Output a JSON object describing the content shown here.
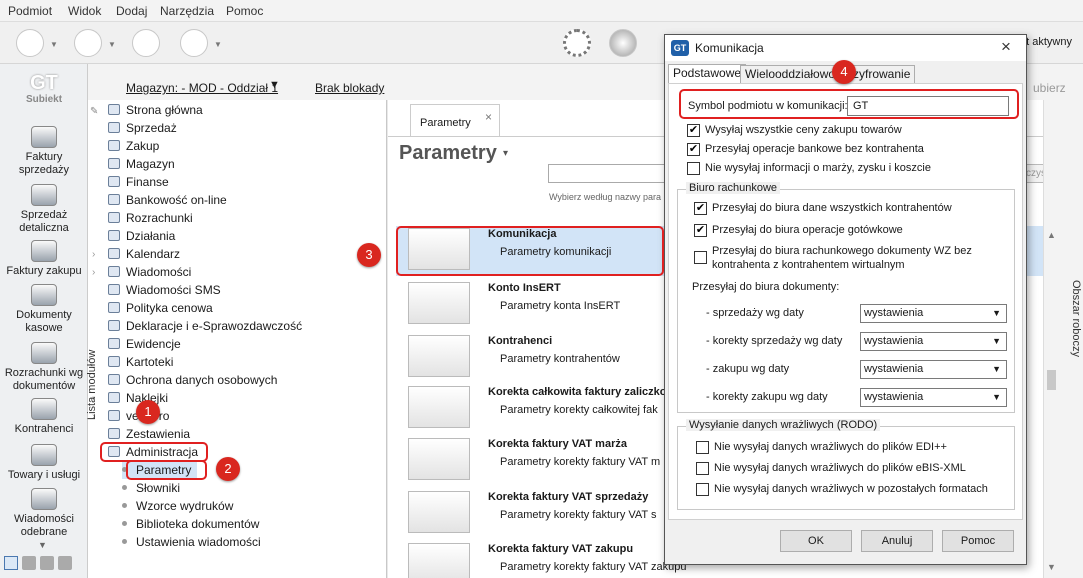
{
  "menubar": {
    "items": [
      "Podmiot",
      "Widok",
      "Dodaj",
      "Narzędzia",
      "Pomoc"
    ]
  },
  "toolbar": {
    "status": "nt aktywny",
    "right_button": "ubierz"
  },
  "app": {
    "logo": "GT",
    "name": "Subiekt"
  },
  "leftnav": {
    "items": [
      {
        "label": "Faktury sprzedaży",
        "icon": "invoice-icon"
      },
      {
        "label": "Sprzedaż detaliczna",
        "icon": "retail-icon"
      },
      {
        "label": "Faktury zakupu",
        "icon": "purchase-icon"
      },
      {
        "label": "Dokumenty kasowe",
        "icon": "cash-icon"
      },
      {
        "label": "Rozrachunki wg dokumentów",
        "icon": "settlements-icon"
      },
      {
        "label": "Kontrahenci",
        "icon": "contractors-icon"
      },
      {
        "label": "Towary i usługi",
        "icon": "goods-icon"
      },
      {
        "label": "Wiadomości odebrane",
        "icon": "messages-icon"
      }
    ]
  },
  "filterbar": {
    "magazyn": "Magazyn: - MOD - Oddział 1",
    "brak_blokady": "Brak blokady"
  },
  "tree": {
    "vertical_label": "Lista modułów",
    "items": [
      "Strona główna",
      "Sprzedaż",
      "Zakup",
      "Magazyn",
      "Finanse",
      "Bankowość on-line",
      "Rozrachunki",
      "Działania",
      "Kalendarz",
      "Wiadomości",
      "Wiadomości SMS",
      "Polityka cenowa",
      "Deklaracje i e-Sprawozdawczość",
      "Ewidencje",
      "Kartoteki",
      "Ochrona danych osobowych",
      "Naklejki",
      "vendero",
      "Zestawienia",
      "Administracja"
    ],
    "subitems": [
      "Parametry",
      "Słowniki",
      "Wzorce wydruków",
      "Biblioteka dokumentów",
      "Ustawienia wiadomości"
    ]
  },
  "main": {
    "tab": "Parametry",
    "title": "Parametry",
    "search_hint": "Wybierz według nazwy para",
    "search_button": "yczyść",
    "rows": [
      {
        "title": "Komunikacja",
        "sub": "Parametry komunikacji"
      },
      {
        "title": "Konto InsERT",
        "sub": "Parametry konta InsERT"
      },
      {
        "title": "Kontrahenci",
        "sub": "Parametry kontrahentów"
      },
      {
        "title": "Korekta całkowita faktury zaliczkow",
        "sub": "Parametry korekty całkowitej fak"
      },
      {
        "title": "Korekta faktury VAT marża",
        "sub": "Parametry korekty faktury VAT m"
      },
      {
        "title": "Korekta faktury VAT sprzedaży",
        "sub": "Parametry korekty faktury VAT s"
      },
      {
        "title": "Korekta faktury VAT zakupu",
        "sub": "Parametry korekty faktury VAT zakupu"
      }
    ]
  },
  "right_strip": {
    "label": "Obszar roboczy"
  },
  "dialog": {
    "title": "Komunikacja",
    "tabs": [
      "Podstawowe",
      "Wielooddziałowość",
      "Szyfrowanie"
    ],
    "symbol_label": "Symbol podmiotu w komunikacji:",
    "symbol_value": "GT",
    "checks_top": [
      {
        "label": "Wysyłaj wszystkie ceny zakupu towarów",
        "checked": true
      },
      {
        "label": "Przesyłaj operacje bankowe bez kontrahenta",
        "checked": true
      },
      {
        "label": "Nie wysyłaj informacji o marży, zysku i koszcie",
        "checked": false
      }
    ],
    "biuro": {
      "title": "Biuro rachunkowe",
      "checks": [
        {
          "label": "Przesyłaj do biura dane wszystkich kontrahentów",
          "checked": true
        },
        {
          "label": "Przesyłaj do biura operacje gotówkowe",
          "checked": true
        },
        {
          "label": "Przesyłaj do biura rachunkowego dokumenty WZ bez",
          "label2": "kontrahenta z kontrahentem wirtualnym",
          "checked": false
        }
      ],
      "docs_label": "Przesyłaj do biura dokumenty:",
      "selects": [
        {
          "label": "- sprzedaży wg daty",
          "value": "wystawienia"
        },
        {
          "label": "- korekty sprzedaży wg daty",
          "value": "wystawienia"
        },
        {
          "label": "- zakupu wg daty",
          "value": "wystawienia"
        },
        {
          "label": "- korekty zakupu wg daty",
          "value": "wystawienia"
        }
      ]
    },
    "rodo": {
      "title": "Wysyłanie danych wrażliwych (RODO)",
      "checks": [
        {
          "label": "Nie wysyłaj danych wrażliwych do plików EDI++",
          "checked": false
        },
        {
          "label": "Nie wysyłaj danych wrażliwych do plików eBIS-XML",
          "checked": false
        },
        {
          "label": "Nie wysyłaj danych wrażliwych w pozostałych formatach",
          "checked": false
        }
      ]
    },
    "buttons": {
      "ok": "OK",
      "cancel": "Anuluj",
      "help": "Pomoc"
    }
  },
  "badges": [
    "1",
    "2",
    "3",
    "4"
  ],
  "colors": {
    "accent": "#1f5fa8",
    "highlight": "#d2e4f7",
    "annotation": "#d9271f"
  }
}
